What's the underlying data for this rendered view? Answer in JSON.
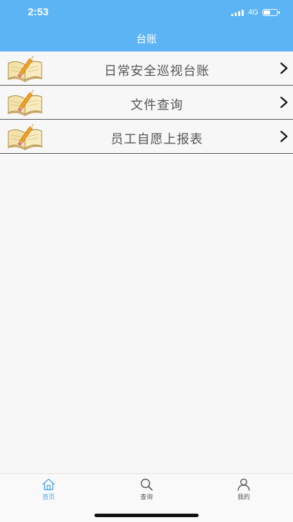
{
  "status_bar": {
    "time": "2:53",
    "network": "4G"
  },
  "header": {
    "title": "台账"
  },
  "list": {
    "items": [
      {
        "label": "日常安全巡视台账",
        "icon": "open-book-pencil-icon"
      },
      {
        "label": "文件查询",
        "icon": "open-book-pencil-icon"
      },
      {
        "label": "员工自愿上报表",
        "icon": "open-book-pencil-icon"
      }
    ]
  },
  "tabbar": {
    "tabs": [
      {
        "label": "首页",
        "icon": "home-icon",
        "active": true
      },
      {
        "label": "查询",
        "icon": "search-icon",
        "active": false
      },
      {
        "label": "我的",
        "icon": "user-icon",
        "active": false
      }
    ]
  },
  "colors": {
    "header_bg": "#5cb4f5",
    "active_tab": "#4aa8f0",
    "page_bg": "#f7f7f7"
  }
}
